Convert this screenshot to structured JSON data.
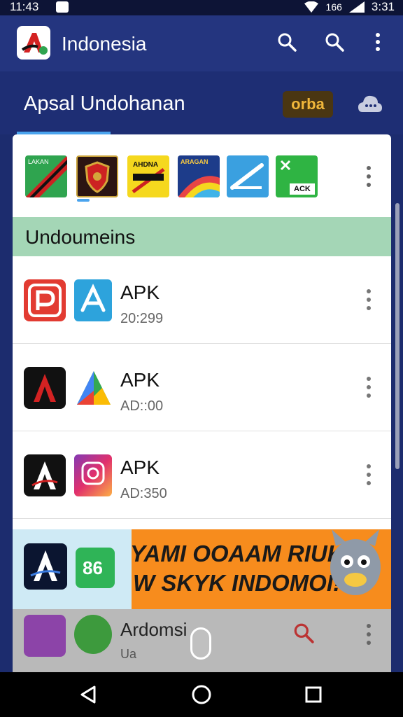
{
  "status": {
    "time": "11:43",
    "battery": "3:31",
    "signal_label": "166"
  },
  "app_bar": {
    "title": "Indonesia",
    "logo_icon": "app-logo-icon",
    "actions": [
      "search-icon",
      "search-icon",
      "more-vert-icon"
    ]
  },
  "sub_header": {
    "title": "Apsal Undohanan",
    "badge": "orba",
    "action_icon": "cloud-icon"
  },
  "icon_strip": {
    "tiles": [
      {
        "name": "app-tile-green",
        "color": "#2fa44f",
        "label": "LAKAN"
      },
      {
        "name": "app-tile-shield",
        "color": "#2b1412",
        "label": ""
      },
      {
        "name": "app-tile-yellow",
        "color": "#f5d81e",
        "label": "AHDNA"
      },
      {
        "name": "app-tile-rainbow",
        "color": "#2255aa",
        "label": "ARAGAN"
      },
      {
        "name": "app-tile-blue",
        "color": "#3aa0e0",
        "label": ""
      },
      {
        "name": "app-tile-green-ack",
        "color": "#2fb443",
        "label": "ACK"
      }
    ]
  },
  "section": {
    "title": "Undoumeins"
  },
  "rows": [
    {
      "title": "APK",
      "sub": "20:299"
    },
    {
      "title": "APK",
      "sub": "AD::00"
    },
    {
      "title": "APK",
      "sub": "AD:350"
    }
  ],
  "banner": {
    "line1": "YAMI OOAAM RIUKI",
    "line2": "W SKYK INDOMOI!",
    "icon2_text": "86"
  },
  "dim_row": {
    "title": "Ardomsi",
    "sub": "Ua"
  },
  "nav": {
    "back": "back-icon",
    "home": "home-icon",
    "recents": "recents-icon"
  },
  "colors": {
    "app_bar": "#24357f",
    "sheet": "#ffffff",
    "section": "#a4d6b6",
    "banner": "#f78c1d"
  }
}
